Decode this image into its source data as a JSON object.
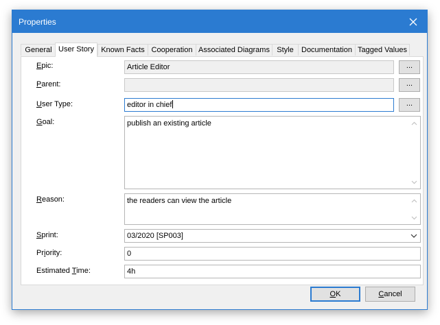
{
  "window": {
    "title": "Properties",
    "accent_color": "#2b7bd1",
    "close_icon": "close-icon"
  },
  "tabs": [
    {
      "label": "General",
      "active": false
    },
    {
      "label": "User Story",
      "active": true
    },
    {
      "label": "Known Facts",
      "active": false
    },
    {
      "label": "Cooperation",
      "active": false
    },
    {
      "label": "Associated Diagrams",
      "active": false
    },
    {
      "label": "Style",
      "active": false
    },
    {
      "label": "Documentation",
      "active": false
    },
    {
      "label": "Tagged Values",
      "active": false
    }
  ],
  "form": {
    "epic": {
      "label_ul": "E",
      "label_rest": "pic:",
      "value": "Article Editor",
      "button": "..."
    },
    "parent": {
      "label_ul": "P",
      "label_rest": "arent:",
      "value": "",
      "button": "..."
    },
    "user_type": {
      "label_ul": "U",
      "label_rest": "ser Type:",
      "value": "editor in chief",
      "button": "..."
    },
    "goal": {
      "label_ul": "G",
      "label_rest": "oal:",
      "value": "publish an existing article"
    },
    "reason": {
      "label_ul": "R",
      "label_rest": "eason:",
      "value": "the readers can view the article"
    },
    "sprint": {
      "label_ul": "S",
      "label_rest": "print:",
      "value": "03/2020 [SP003]"
    },
    "priority": {
      "label_pre": "Pr",
      "label_ul": "i",
      "label_rest": "ority:",
      "value": "0"
    },
    "estimated_time": {
      "label_pre": "Estimated ",
      "label_ul": "T",
      "label_rest": "ime:",
      "value": "4h"
    }
  },
  "buttons": {
    "ok": {
      "label_ul": "O",
      "label_rest": "K"
    },
    "cancel": {
      "label_ul": "C",
      "label_rest": "ancel"
    }
  }
}
